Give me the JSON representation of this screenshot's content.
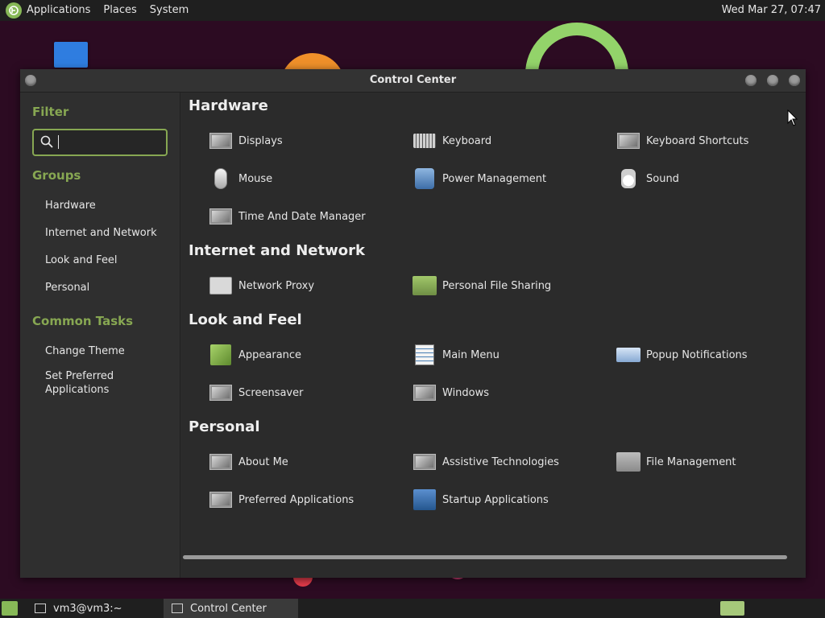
{
  "top_panel": {
    "menus": [
      "Applications",
      "Places",
      "System"
    ],
    "clock": "Wed Mar 27, 07:47"
  },
  "window": {
    "title": "Control Center"
  },
  "sidebar": {
    "filter_heading": "Filter",
    "search": {
      "value": "",
      "placeholder": ""
    },
    "groups_heading": "Groups",
    "groups": [
      "Hardware",
      "Internet and Network",
      "Look and Feel",
      "Personal"
    ],
    "tasks_heading": "Common Tasks",
    "tasks": [
      "Change Theme",
      "Set Preferred Applications"
    ]
  },
  "sections": [
    {
      "title": "Hardware",
      "items": [
        {
          "label": "Displays",
          "icon": "display-icon"
        },
        {
          "label": "Keyboard",
          "icon": "keyboard-icon"
        },
        {
          "label": "Keyboard Shortcuts",
          "icon": "keyboard-shortcuts-icon"
        },
        {
          "label": "Mouse",
          "icon": "mouse-icon"
        },
        {
          "label": "Power Management",
          "icon": "power-management-icon"
        },
        {
          "label": "Sound",
          "icon": "sound-icon"
        },
        {
          "label": "Time And Date Manager",
          "icon": "time-date-icon"
        }
      ]
    },
    {
      "title": "Internet and Network",
      "items": [
        {
          "label": "Network Proxy",
          "icon": "network-proxy-icon"
        },
        {
          "label": "Personal File Sharing",
          "icon": "folder-icon"
        }
      ]
    },
    {
      "title": "Look and Feel",
      "items": [
        {
          "label": "Appearance",
          "icon": "appearance-icon"
        },
        {
          "label": "Main Menu",
          "icon": "main-menu-icon"
        },
        {
          "label": "Popup Notifications",
          "icon": "popup-notifications-icon"
        },
        {
          "label": "Screensaver",
          "icon": "screensaver-icon"
        },
        {
          "label": "Windows",
          "icon": "windows-icon"
        }
      ]
    },
    {
      "title": "Personal",
      "items": [
        {
          "label": "About Me",
          "icon": "about-me-icon"
        },
        {
          "label": "Assistive Technologies",
          "icon": "assistive-technologies-icon"
        },
        {
          "label": "File Management",
          "icon": "file-management-icon"
        },
        {
          "label": "Preferred Applications",
          "icon": "preferred-applications-icon"
        },
        {
          "label": "Startup Applications",
          "icon": "startup-applications-icon"
        }
      ]
    }
  ],
  "taskbar": {
    "tasks": [
      "vm3@vm3:~",
      "Control Center"
    ]
  },
  "colors": {
    "accent": "#87a752",
    "panel": "#1f1f1f",
    "window_bg": "#2b2b2b"
  }
}
